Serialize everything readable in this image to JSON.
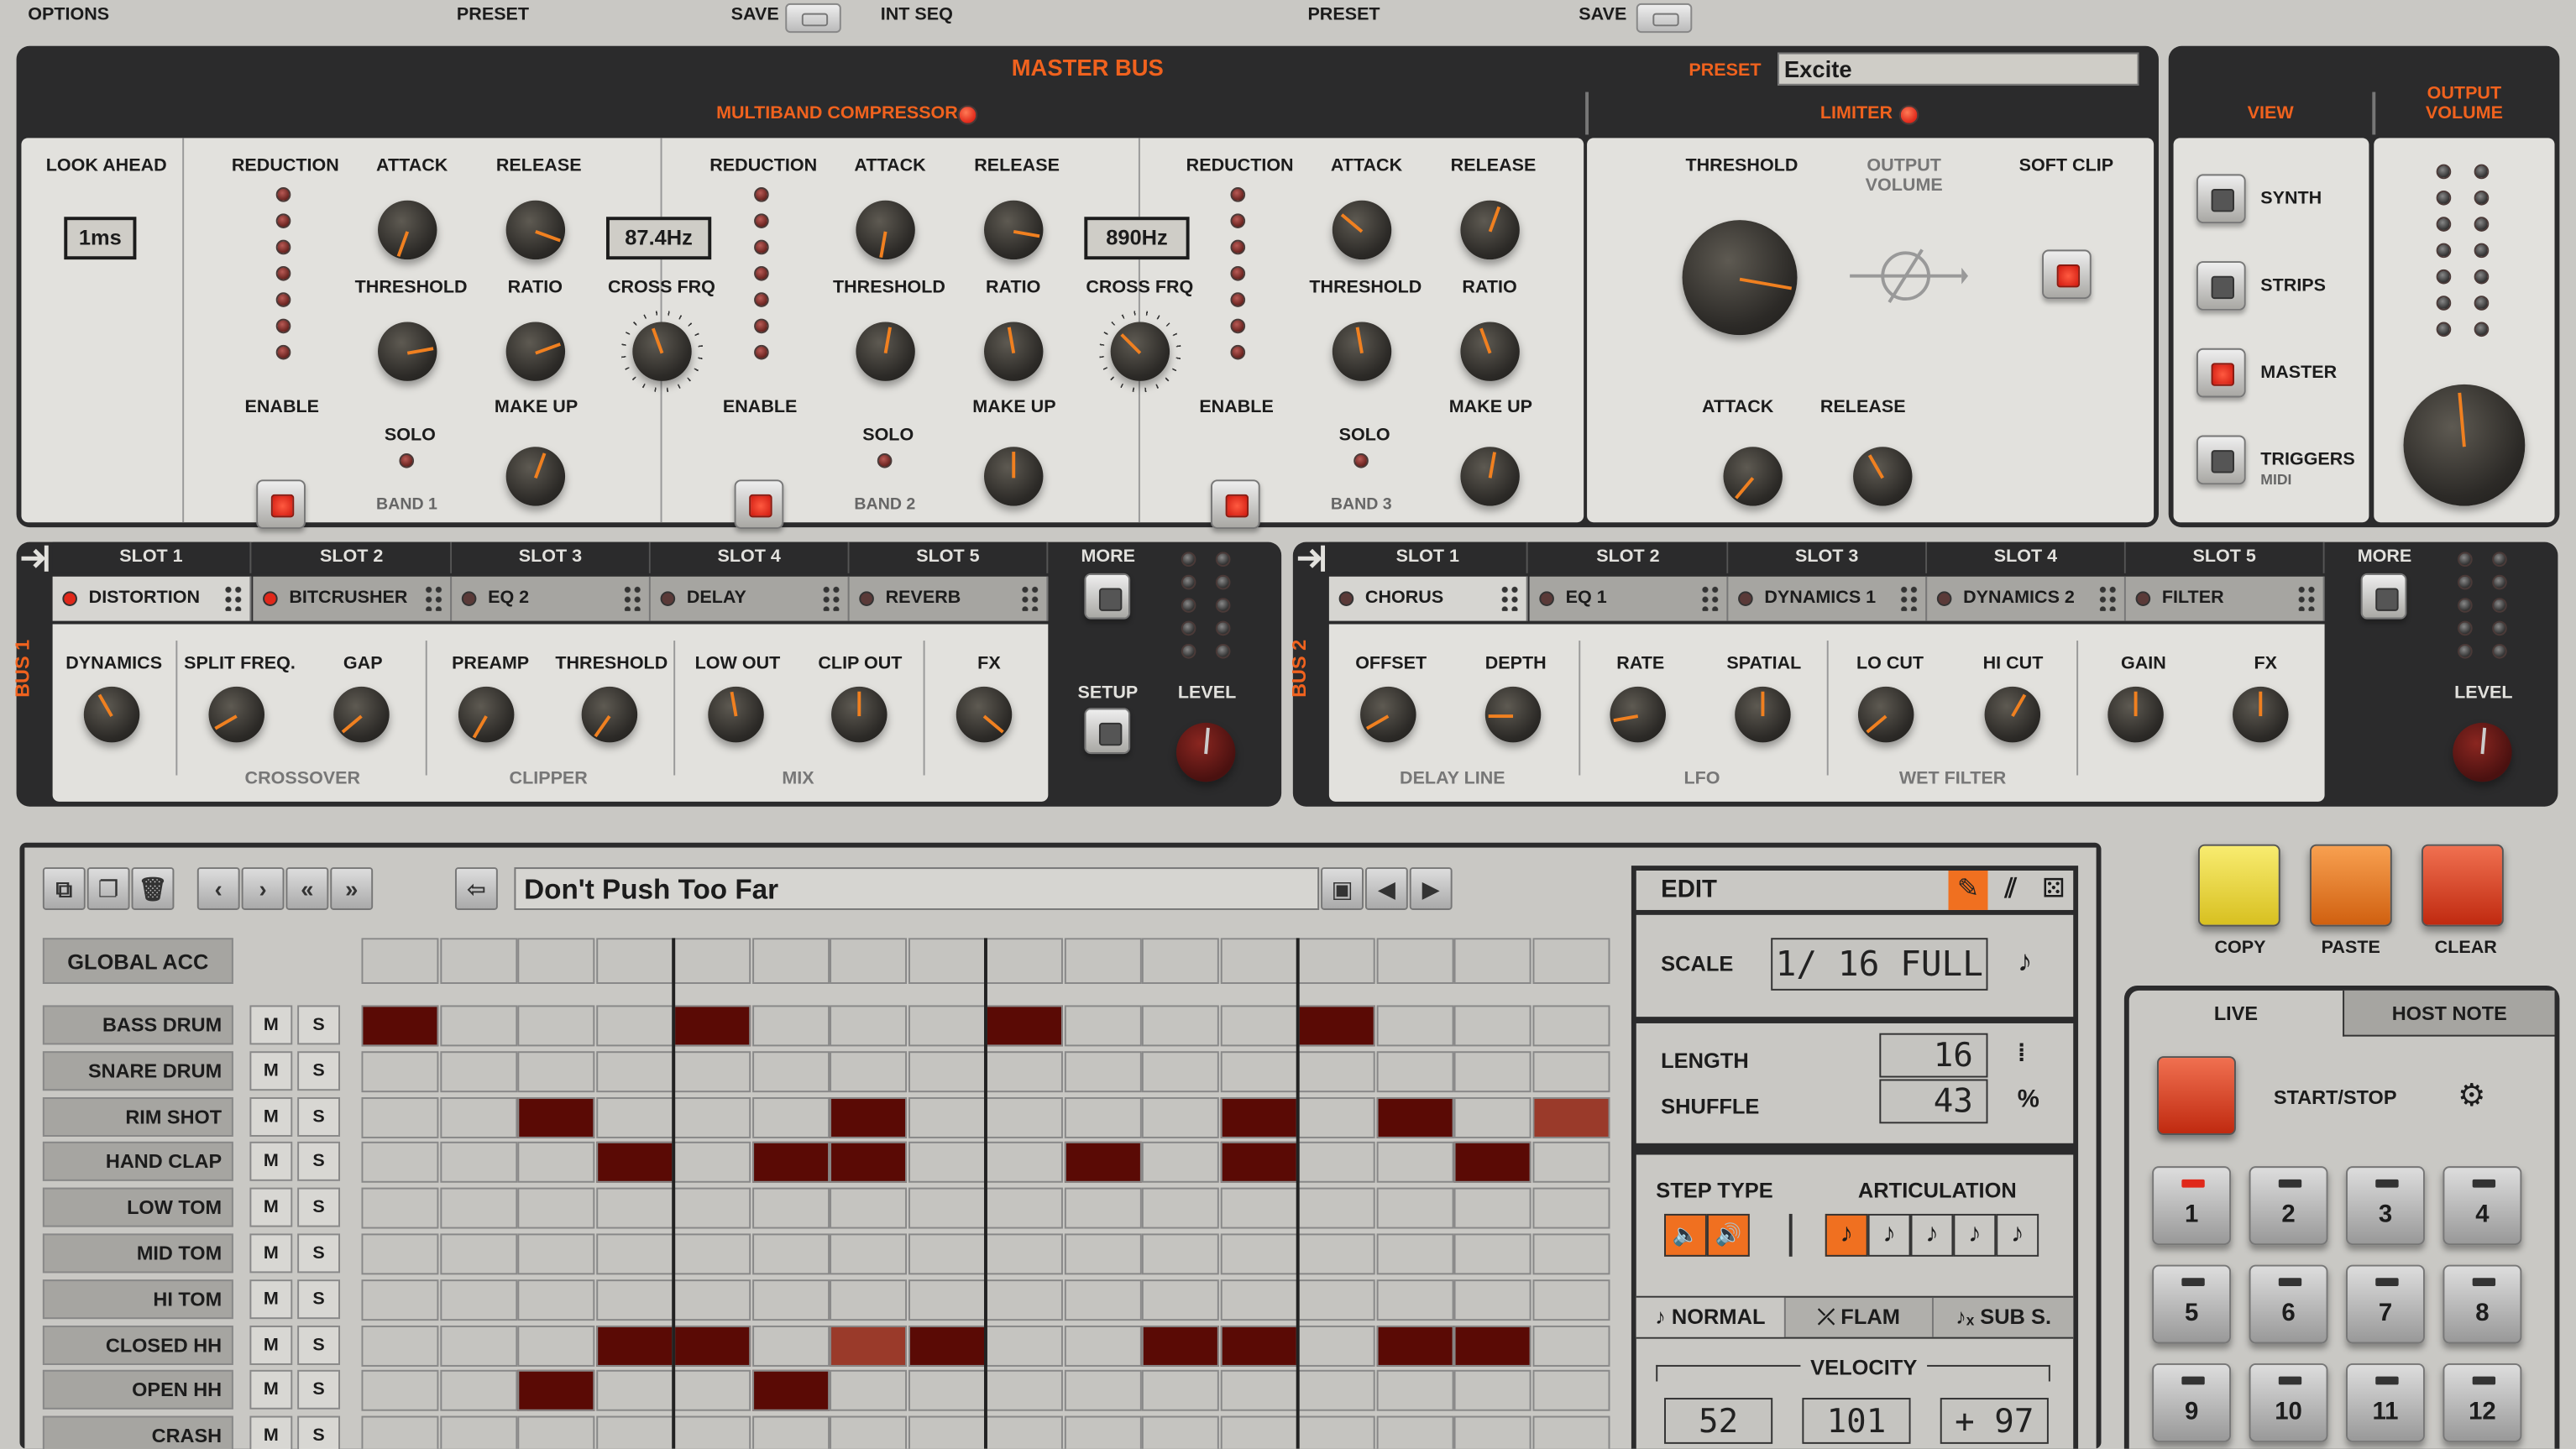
{
  "topbar": {
    "options": "OPTIONS",
    "preset1": "PRESET",
    "save1": "SAVE",
    "intseq": "INT SEQ",
    "preset2": "PRESET",
    "save2": "SAVE"
  },
  "master": {
    "title": "MASTER BUS",
    "preset_label": "PRESET",
    "preset_value": "Excite",
    "mbc": "MULTIBAND COMPRESSOR",
    "limiter": "LIMITER",
    "lookahead": "LOOK AHEAD",
    "lookahead_value": "1ms",
    "reduction": "REDUCTION",
    "attack": "ATTACK",
    "release": "RELEASE",
    "threshold": "THRESHOLD",
    "ratio": "RATIO",
    "crossfrq": "CROSS FRQ",
    "enable": "ENABLE",
    "solo": "SOLO",
    "makeup": "MAKE UP",
    "band1": "BAND 1",
    "band2": "BAND 2",
    "band3": "BAND 3",
    "cross1": "87.4Hz",
    "cross2": "890Hz",
    "lim_threshold": "THRESHOLD",
    "lim_output": "OUTPUT VOLUME",
    "lim_softclip": "SOFT CLIP",
    "lim_attack": "ATTACK",
    "lim_release": "RELEASE"
  },
  "view": {
    "title": "VIEW",
    "output": "OUTPUT VOLUME",
    "synth": "SYNTH",
    "strips": "STRIPS",
    "master": "MASTER",
    "triggers": "TRIGGERS",
    "midi": "MIDI"
  },
  "bus1": {
    "name": "BUS 1",
    "slots": [
      "SLOT 1",
      "SLOT 2",
      "SLOT 3",
      "SLOT 4",
      "SLOT 5"
    ],
    "fx": [
      "DISTORTION",
      "BITCRUSHER",
      "EQ 2",
      "DELAY",
      "REVERB"
    ],
    "more": "MORE",
    "setup": "SETUP",
    "level": "LEVEL",
    "params": [
      "DYNAMICS",
      "SPLIT FREQ.",
      "GAP",
      "PREAMP",
      "THRESHOLD",
      "LOW OUT",
      "CLIP OUT",
      "FX"
    ],
    "groups": [
      "CROSSOVER",
      "CLIPPER",
      "MIX"
    ]
  },
  "bus2": {
    "name": "BUS 2",
    "slots": [
      "SLOT 1",
      "SLOT 2",
      "SLOT 3",
      "SLOT 4",
      "SLOT 5"
    ],
    "fx": [
      "CHORUS",
      "EQ 1",
      "DYNAMICS 1",
      "DYNAMICS 2",
      "FILTER"
    ],
    "more": "MORE",
    "level": "LEVEL",
    "params": [
      "OFFSET",
      "DEPTH",
      "RATE",
      "SPATIAL",
      "LO CUT",
      "HI CUT",
      "GAIN",
      "FX"
    ],
    "groups": [
      "DELAY LINE",
      "LFO",
      "WET FILTER"
    ]
  },
  "seq": {
    "pattern_name": "Don't Push Too Far",
    "global_acc": "GLOBAL ACC",
    "m": "M",
    "s": "S",
    "rows": [
      "BASS DRUM",
      "SNARE DRUM",
      "RIM SHOT",
      "HAND CLAP",
      "LOW TOM",
      "MID TOM",
      "HI TOM",
      "CLOSED HH",
      "OPEN HH",
      "CRASH"
    ],
    "grid": [
      [
        1,
        0,
        0,
        0,
        1,
        0,
        0,
        0,
        1,
        0,
        0,
        0,
        1,
        0,
        0,
        0
      ],
      [
        0,
        0,
        0,
        0,
        0,
        0,
        0,
        0,
        0,
        0,
        0,
        0,
        0,
        0,
        0,
        0
      ],
      [
        0,
        0,
        1,
        0,
        0,
        0,
        1,
        0,
        0,
        0,
        0,
        1,
        0,
        1,
        0,
        2
      ],
      [
        0,
        0,
        0,
        1,
        0,
        1,
        1,
        0,
        0,
        1,
        0,
        1,
        0,
        0,
        1,
        0
      ],
      [
        0,
        0,
        0,
        0,
        0,
        0,
        0,
        0,
        0,
        0,
        0,
        0,
        0,
        0,
        0,
        0
      ],
      [
        0,
        0,
        0,
        0,
        0,
        0,
        0,
        0,
        0,
        0,
        0,
        0,
        0,
        0,
        0,
        0
      ],
      [
        0,
        0,
        0,
        0,
        0,
        0,
        0,
        0,
        0,
        0,
        0,
        0,
        0,
        0,
        0,
        0
      ],
      [
        0,
        0,
        0,
        1,
        1,
        0,
        2,
        1,
        0,
        0,
        1,
        1,
        0,
        1,
        1,
        0
      ],
      [
        0,
        0,
        1,
        0,
        0,
        1,
        0,
        0,
        0,
        0,
        0,
        0,
        0,
        0,
        0,
        0
      ],
      [
        0,
        0,
        0,
        0,
        0,
        0,
        0,
        0,
        0,
        0,
        0,
        0,
        0,
        0,
        0,
        0
      ]
    ]
  },
  "edit": {
    "title": "EDIT",
    "scale": "SCALE",
    "scale_value": "1/ 16 FULL",
    "length": "LENGTH",
    "length_value": "16",
    "shuffle": "SHUFFLE",
    "shuffle_value": "43",
    "step_type": "STEP TYPE",
    "articulation": "ARTICULATION",
    "normal": "NORMAL",
    "flam": "FLAM",
    "sub": "SUB S.",
    "velocity": "VELOCITY",
    "vel1": "52",
    "vel2": "101",
    "vel3": "+ 97"
  },
  "right": {
    "copy": "COPY",
    "paste": "PASTE",
    "clear": "CLEAR",
    "live": "LIVE",
    "host_note": "HOST NOTE",
    "start_stop": "START/STOP",
    "pads": [
      "1",
      "2",
      "3",
      "4",
      "5",
      "6",
      "7",
      "8",
      "9",
      "10",
      "11",
      "12"
    ]
  }
}
